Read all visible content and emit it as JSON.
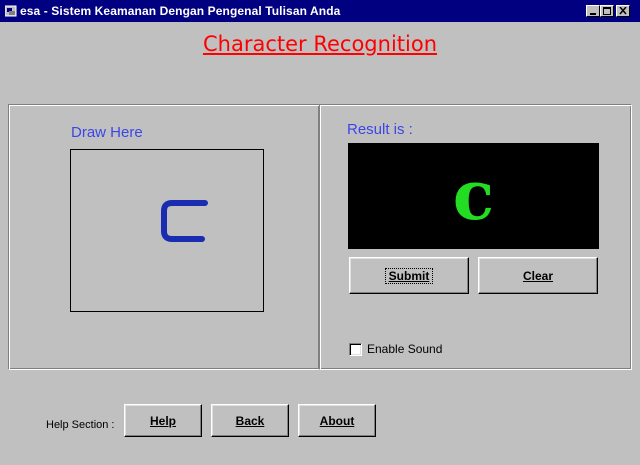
{
  "window": {
    "title": "esa - Sistem Keamanan Dengan Pengenal Tulisan Anda"
  },
  "header": {
    "heading": "Character Recognition"
  },
  "draw_panel": {
    "label": "Draw Here"
  },
  "result_panel": {
    "label": "Result is :",
    "recognized_char": "c",
    "submit_label": "Submit",
    "clear_label": "Clear"
  },
  "options": {
    "enable_sound_label": "Enable Sound",
    "enable_sound_checked": false
  },
  "help_section": {
    "label": "Help Section :",
    "help_label": "Help",
    "back_label": "Back",
    "about_label": "About"
  },
  "colors": {
    "titlebar": "#000080",
    "heading": "#ff0000",
    "label": "#3c46e6",
    "stroke": "#1a2db0",
    "result_char": "#22dd22"
  }
}
